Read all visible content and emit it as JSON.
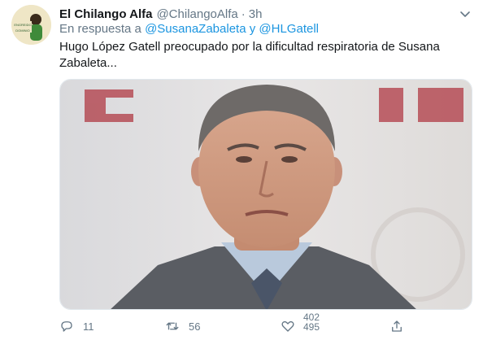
{
  "tweet": {
    "display_name": "El Chilango Alfa",
    "handle": "@ChilangoAlfa",
    "separator": "·",
    "time": "3h",
    "reply_prefix": "En respuesta a ",
    "reply_mention_1": "@SusanaZabaleta",
    "reply_joiner": " y ",
    "reply_mention_2": "@HLGatell",
    "text": "Hugo López Gatell preocupado por la dificultad respiratoria de Susana Zabaleta...",
    "media_alt": "Photo of a man in a suit",
    "avatar_text_1": "ENGREIDO",
    "avatar_text_2": "DOMINIO"
  },
  "actions": {
    "reply_count": "11",
    "retweet_count": "56",
    "like_count_top": "402",
    "like_count_bottom": "495"
  },
  "icons": {
    "more": "chevron-down-icon",
    "reply": "reply-icon",
    "retweet": "retweet-icon",
    "like": "heart-icon",
    "share": "share-icon"
  },
  "colors": {
    "link": "#1b95e0",
    "muted": "#657786",
    "text": "#14171a"
  }
}
